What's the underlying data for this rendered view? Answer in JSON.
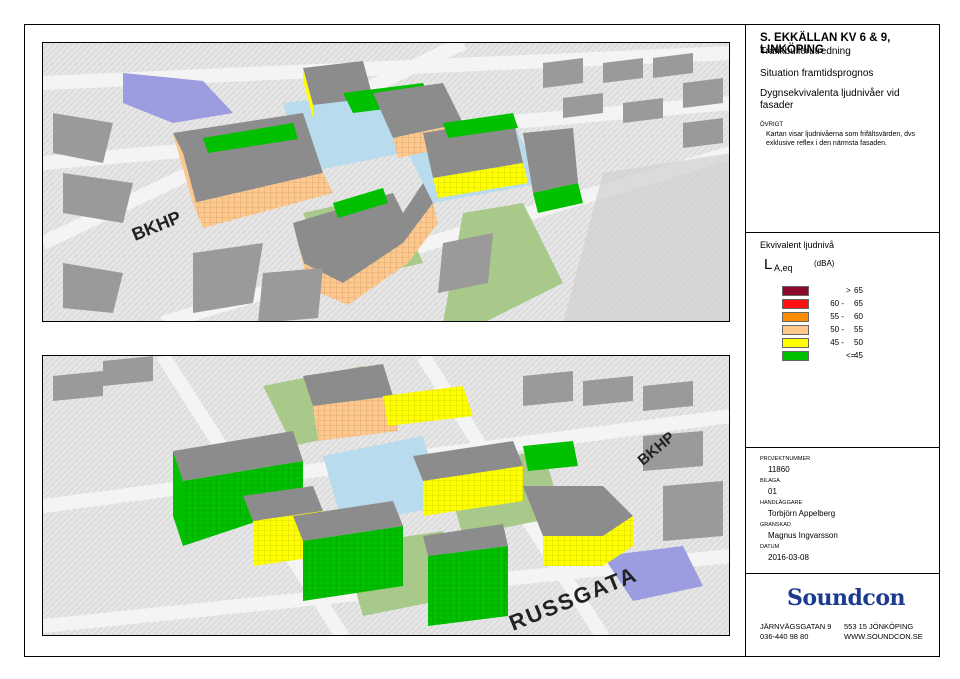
{
  "title": "S. EKKÄLLAN KV 6 & 9, LINKÖPING",
  "subtitle": "Trafikbullerutredning",
  "situation": "Situation framtidsprognos",
  "description": "Dygnsekvivalenta ljudnivåer vid fasader",
  "note_heading": "ÖVRIGT",
  "note": "Kartan visar ljudnivåerna som frifältsvärden, dvs exklusive reflex i den närmsta fasaden.",
  "legend": {
    "title": "Ekvivalent ljudnivå",
    "symbol": "L",
    "symbol_sub": "A,eq",
    "unit": "(dBA)",
    "items": [
      {
        "left": "",
        "dash": ">",
        "right": "65",
        "color": "#8b0a2c"
      },
      {
        "left": "60 -",
        "dash": "",
        "right": "65",
        "color": "#ff1010"
      },
      {
        "left": "55 -",
        "dash": "",
        "right": "60",
        "color": "#ff8c00"
      },
      {
        "left": "50 -",
        "dash": "",
        "right": "55",
        "color": "#ffc88c"
      },
      {
        "left": "45 -",
        "dash": "",
        "right": "50",
        "color": "#ffff00"
      },
      {
        "left": "",
        "dash": "<=",
        "right": "45",
        "color": "#00c000"
      }
    ]
  },
  "meta": {
    "project_label": "PROJEKTNUMMER",
    "project_value": "11860",
    "bilaga_label": "BILAGA",
    "bilaga_value": "01",
    "handlaggare_label": "HANDLÄGGARE",
    "handlaggare_value": "Torbjörn Appelberg",
    "granskad_label": "GRANSKAD",
    "granskad_value": "Magnus Ingvarsson",
    "datum_label": "DATUM",
    "datum_value": "2016-03-08"
  },
  "logo": "Soundcon",
  "address": {
    "street": "JÄRNVÄGSGATAN 9",
    "phone": "036-440 98 80",
    "city": "553 15 JÖNKÖPING",
    "web": "WWW.SOUNDCON.SE"
  },
  "map_labels": {
    "top_street": "BKHP",
    "bottom_street": "RUSSGATA",
    "bottom_sign": "BKHP"
  },
  "colors": {
    "terrain": "#d8d8d8",
    "roof": "#8c8c8c",
    "plaza": "#b8dced",
    "park": "#a8c98a",
    "accent": "#1d3b8e",
    "lowrise": "#9c9ce0"
  }
}
